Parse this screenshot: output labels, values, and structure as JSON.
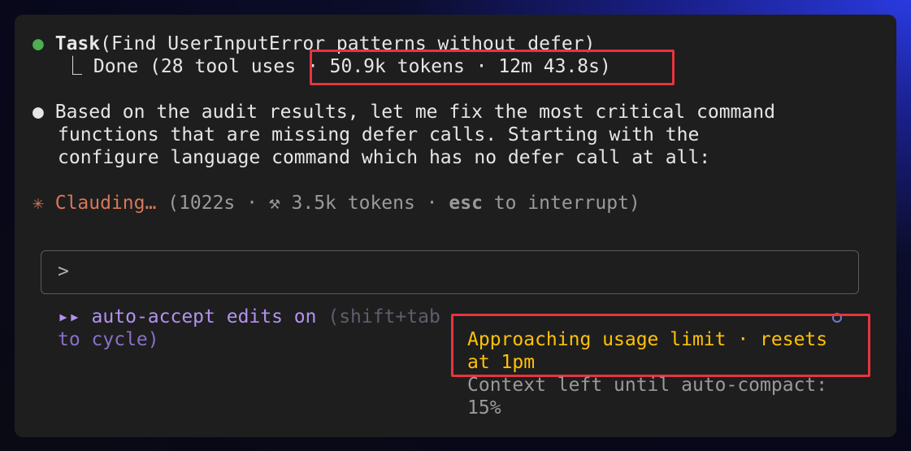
{
  "task": {
    "bullet": "●",
    "name": "Task",
    "args": "(Find UserInputError patterns without defer)",
    "result_prefix": "⎿ Done (28 tool uses · ",
    "result_highlight": "50.9k tokens · 12m 43.8s",
    "result_suffix": ")"
  },
  "message": {
    "bullet": "●",
    "lines": [
      "Based on the audit results, let me fix the most critical command",
      "functions that are missing defer calls. Starting with the",
      "configure language command which has no defer call at all:"
    ]
  },
  "status": {
    "spinner": "✳",
    "label": "Clauding…",
    "detail_prefix": " (1022s · ⚒ 3.5k tokens · ",
    "key": "esc",
    "detail_suffix": " to interrupt)"
  },
  "input": {
    "prompt": ">"
  },
  "footer": {
    "mode_icon": "▸▸",
    "mode_label": " auto-accept edits on",
    "mode_hint_1": " (shift+tab",
    "mode_hint_2": "to cycle)",
    "usage_line_1": "Approaching usage limit · resets",
    "usage_line_2": "at 1pm",
    "context_line_1": "Context left until auto-compact:",
    "context_line_2": "15%"
  },
  "colors": {
    "accent_orange": "#d77757",
    "accent_purple": "#b392f0",
    "warning_yellow": "#ffc107",
    "highlight_red": "#e8343f",
    "success_green": "#4caf50"
  }
}
